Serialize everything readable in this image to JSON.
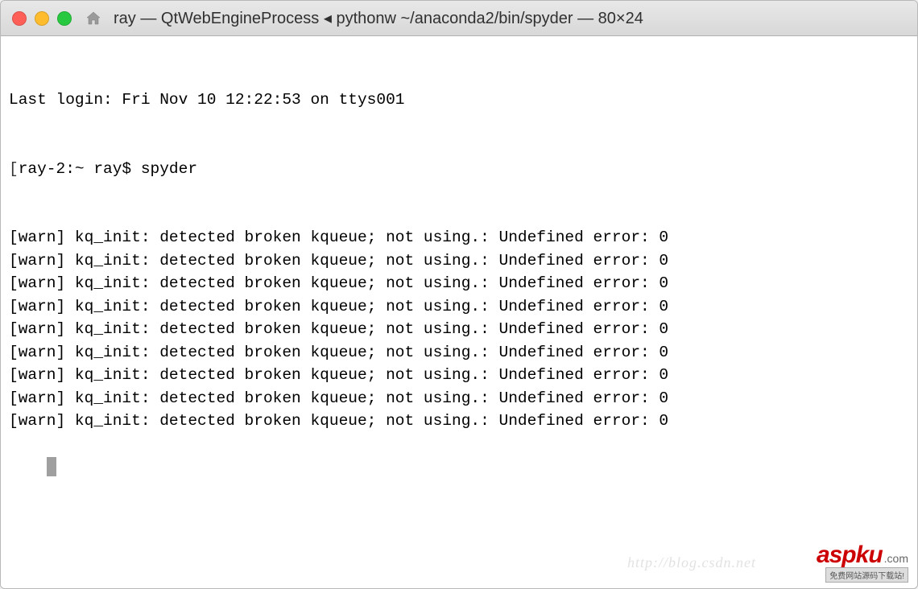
{
  "window": {
    "title": "ray — QtWebEngineProcess ◂ pythonw ~/anaconda2/bin/spyder — 80×24"
  },
  "terminal": {
    "last_login": "Last login: Fri Nov 10 12:22:53 on ttys001",
    "prompt": "ray-2:~ ray$ ",
    "command": "spyder",
    "warn_line": "[warn] kq_init: detected broken kqueue; not using.: Undefined error: 0",
    "warn_count": 9
  },
  "watermark": {
    "brand": "aspku",
    "tld": ".com",
    "tagline": "免费网站源码下载站!",
    "faint": "http://blog.csdn.net"
  }
}
